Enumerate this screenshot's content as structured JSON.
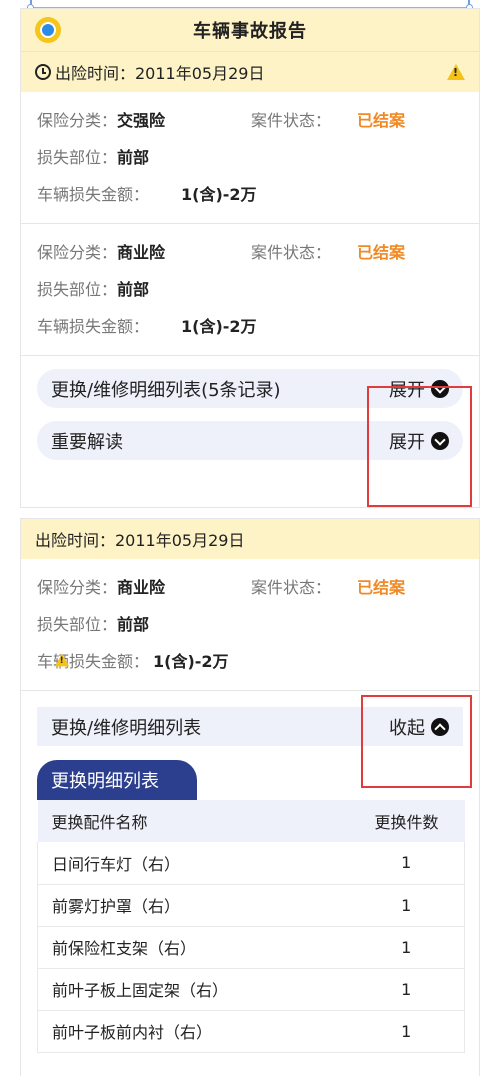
{
  "report": {
    "title": "车辆事故报告",
    "date_label": "出险时间：2011年05月29日"
  },
  "labels": {
    "type": "保险分类：",
    "status": "案件状态：",
    "part": "损失部位：",
    "amount": "车辆损失金额："
  },
  "claims": [
    {
      "type": "交强险",
      "status": "已结案",
      "part": "前部",
      "amount": "1(含)-2万"
    },
    {
      "type": "商业险",
      "status": "已结案",
      "part": "前部",
      "amount": "1(含)-2万"
    }
  ],
  "sections": {
    "details_label": "更换/维修明细列表(5条记录)",
    "details_toggle": "展开",
    "interpret_label": "重要解读",
    "interpret_toggle": "展开"
  },
  "card2": {
    "date_label": "出险时间：2011年05月29日",
    "claim": {
      "type": "商业险",
      "status": "已结案",
      "part": "前部",
      "amount": "1(含)-2万"
    },
    "details_label": "更换/维修明细列表",
    "details_toggle": "收起",
    "tab_title": "更换明细列表",
    "table": {
      "headers": [
        "更换配件名称",
        "更换件数"
      ],
      "rows": [
        [
          "日间行车灯（右）",
          "1"
        ],
        [
          "前雾灯护罩（右）",
          "1"
        ],
        [
          "前保险杠支架（右）",
          "1"
        ],
        [
          "前叶子板上固定架（右）",
          "1"
        ],
        [
          "前叶子板前内衬（右）",
          "1"
        ]
      ]
    }
  },
  "colors": {
    "header_bg": "#fef3c6",
    "status": "#f08a24",
    "tab": "#2b3f8e",
    "highlight": "#e23b3b"
  },
  "icons": [
    "logo-icon",
    "clock-icon",
    "warning-icon",
    "chevron-down-icon",
    "chevron-up-icon"
  ]
}
